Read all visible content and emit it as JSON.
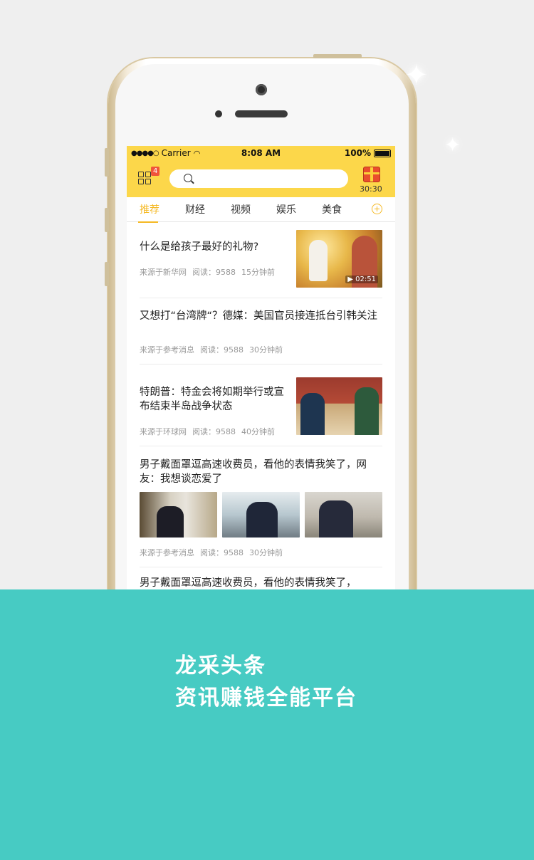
{
  "status_bar": {
    "carrier": "Carrier",
    "time": "8:08 AM",
    "battery": "100%"
  },
  "header": {
    "badge_count": "4",
    "timer": "30:30"
  },
  "tabs": [
    {
      "label": "推荐",
      "active": true
    },
    {
      "label": "财经"
    },
    {
      "label": "视频"
    },
    {
      "label": "娱乐"
    },
    {
      "label": "美食"
    }
  ],
  "articles": [
    {
      "title": "什么是给孩子最好的礼物?",
      "source": "来源于新华网",
      "reads": "阅读：9588",
      "time": "15分钟前",
      "duration": "02:51"
    },
    {
      "title": "又想打“台湾牌“？德媒：美国官员接连抵台引韩关注",
      "source": "来源于参考消息",
      "reads": "阅读：9588",
      "time": "30分钟前"
    },
    {
      "title": "特朗普：特金会将如期举行或宣布结束半岛战争状态",
      "source": "来源于环球网",
      "reads": "阅读：9588",
      "time": "40分钟前"
    },
    {
      "title": "男子戴面罩逗高速收费员，看他的表情我笑了，网友：我想谈恋爱了",
      "source": "来源于参考消息",
      "reads": "阅读：9588",
      "time": "30分钟前"
    },
    {
      "title": "男子戴面罩逗高速收费员，看他的表情我笑了，"
    }
  ],
  "promo": {
    "line1": "龙采头条",
    "line2": "资讯赚钱全能平台"
  },
  "colors": {
    "header_yellow": "#fcd74a",
    "accent": "#f5b923",
    "teal": "#47cbc3"
  }
}
